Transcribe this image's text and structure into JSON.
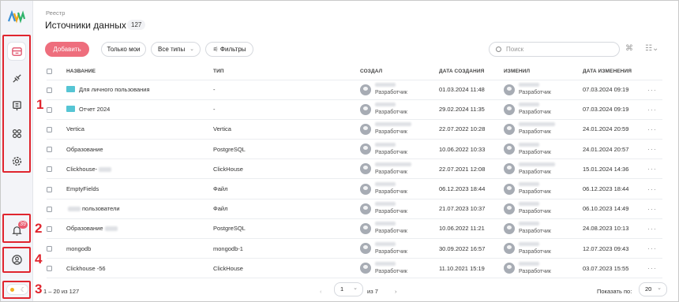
{
  "colors": {
    "accent": "#ee6e7d",
    "highlight": "#e0252e",
    "folder": "#56c5d4"
  },
  "annotations": [
    "1",
    "2",
    "3",
    "4"
  ],
  "sidebar": {
    "notification_count": "39"
  },
  "header": {
    "breadcrumb": "Реестр",
    "title": "Источники данных",
    "count": "127"
  },
  "toolbar": {
    "add_label": "Добавить",
    "only_mine_label": "Только мои",
    "all_types_label": "Все типы",
    "filters_label": "Фильтры",
    "search_placeholder": "Поиск"
  },
  "table": {
    "columns": [
      "НАЗВАНИЕ",
      "ТИП",
      "СОЗДАЛ",
      "ДАТА СОЗДАНИЯ",
      "ИЗМЕНИЛ",
      "ДАТА ИЗМЕНЕНИЯ"
    ],
    "rows": [
      {
        "name": "Для личного пользования",
        "type": "-",
        "creator_role": "Разработчик",
        "created": "01.03.2024 11:48",
        "modifier_role": "Разработчик",
        "modified": "07.03.2024 09:19"
      },
      {
        "name": "Отчет 2024",
        "type": "-",
        "creator_role": "Разработчик",
        "created": "29.02.2024 11:35",
        "modifier_role": "Разработчик",
        "modified": "07.03.2024 09:19"
      },
      {
        "name": "Vertica",
        "type": "Vertica",
        "creator_role": "Разработчик",
        "created": "22.07.2022 10:28",
        "modifier_role": "Разработчик",
        "modified": "24.01.2024 20:59"
      },
      {
        "name": "Образование",
        "type": "PostgreSQL",
        "creator_role": "Разработчик",
        "created": "10.06.2022 10:33",
        "modifier_role": "Разработчик",
        "modified": "24.01.2024 20:57"
      },
      {
        "name": "Clickhouse-",
        "type": "ClickHouse",
        "creator_role": "Разработчик",
        "created": "22.07.2021 12:08",
        "modifier_role": "Разработчик",
        "modified": "15.01.2024 14:36"
      },
      {
        "name": "EmptyFields",
        "type": "Файл",
        "creator_role": "Разработчик",
        "created": "06.12.2023 18:44",
        "modifier_role": "Разработчик",
        "modified": "06.12.2023 18:44"
      },
      {
        "name": "пользователи",
        "type": "Файл",
        "creator_role": "Разработчик",
        "created": "21.07.2023 10:37",
        "modifier_role": "Разработчик",
        "modified": "06.10.2023 14:49"
      },
      {
        "name": "Образование",
        "type": "PostgreSQL",
        "creator_role": "Разработчик",
        "created": "10.06.2022 11:21",
        "modifier_role": "Разработчик",
        "modified": "24.08.2023 10:13"
      },
      {
        "name": "mongodb",
        "type": "mongodb-1",
        "creator_role": "Разработчик",
        "created": "30.09.2022 16:57",
        "modifier_role": "Разработчик",
        "modified": "12.07.2023 09:43"
      },
      {
        "name": "Clickhouse -56",
        "type": "ClickHouse",
        "creator_role": "Разработчик",
        "created": "11.10.2021 15:19",
        "modifier_role": "Разработчик",
        "modified": "03.07.2023 15:55"
      }
    ]
  },
  "footer": {
    "range": "1 – 20 из 127",
    "page": "1",
    "of_pages": "из 7",
    "page_size_label": "Показать по:",
    "page_size": "20"
  }
}
